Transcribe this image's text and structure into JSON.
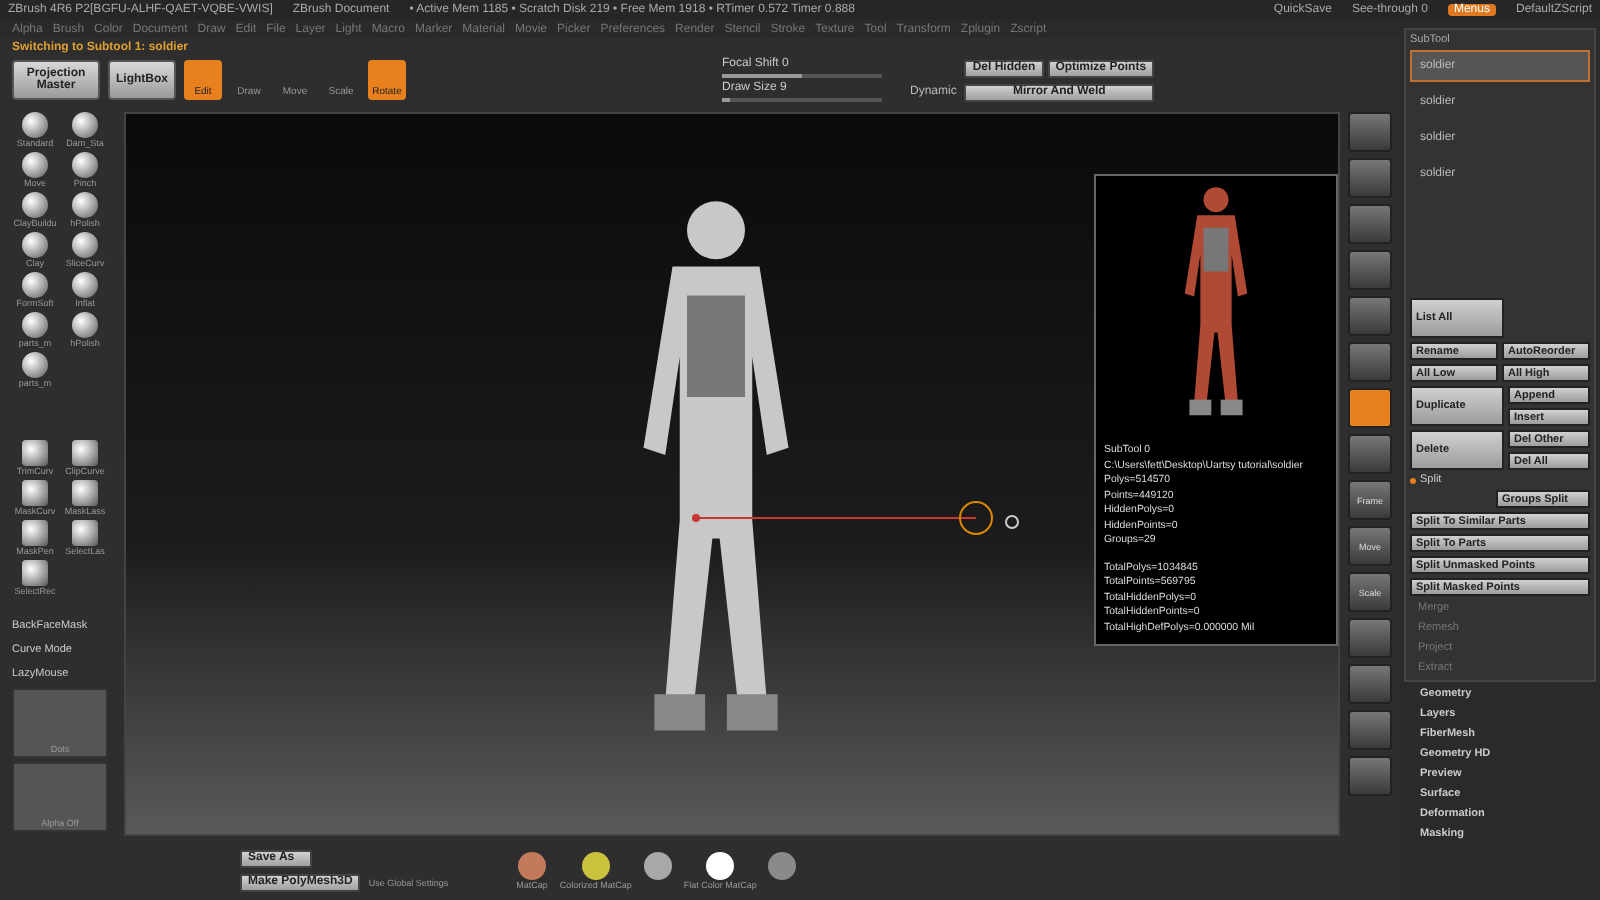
{
  "title_bar": {
    "title": "ZBrush 4R6 P2[BGFU-ALHF-QAET-VQBE-VWIS]",
    "document": "ZBrush Document",
    "stats": "• Active Mem 1185 • Scratch Disk 219 • Free Mem 1918 • RTimer 0.572 Timer 0.888",
    "quick_save": "QuickSave",
    "see_through": "See-through 0",
    "menus": "Menus",
    "script": "DefaultZScript",
    "menus_on": true
  },
  "menu_bar": [
    "Alpha",
    "Brush",
    "Color",
    "Document",
    "Draw",
    "Edit",
    "File",
    "Layer",
    "Light",
    "Macro",
    "Marker",
    "Material",
    "Movie",
    "Picker",
    "Preferences",
    "Render",
    "Stencil",
    "Stroke",
    "Texture",
    "Tool",
    "Transform",
    "Zplugin",
    "Zscript"
  ],
  "status": "Switching to Subtool 1: soldier",
  "toolbar": {
    "large_buttons": [
      "Projection Master",
      "LightBox"
    ],
    "modes": [
      {
        "label": "Edit",
        "selected": true
      },
      {
        "label": "Draw",
        "selected": false
      },
      {
        "label": "Move",
        "selected": false
      },
      {
        "label": "Scale",
        "selected": false
      },
      {
        "label": "Rotate",
        "selected": true
      }
    ],
    "sliders": [
      {
        "label": "Focal Shift 0",
        "level": 0.5
      },
      {
        "label": "Draw Size 9",
        "level": 0.05
      }
    ],
    "dynamic": "Dynamic",
    "buttons": [
      "Del Hidden",
      "Optimize Points"
    ],
    "mirror": "Mirror And Weld"
  },
  "brushes": [
    "Standard",
    "Dam_Sta",
    "Move",
    "Pinch",
    "ClayBuildu",
    "hPolish",
    "Clay",
    "SliceCurv",
    "FormSoft",
    "Inflat",
    "parts_m",
    "hPolish",
    "parts_m"
  ],
  "selection_tools": [
    "TrimCurv",
    "ClipCurve",
    "MaskCurv",
    "MaskLass",
    "MaskPen",
    "SelectLas",
    "SelectRec"
  ],
  "shelf_toggles": [
    "BackFaceMask",
    "Curve Mode",
    "LazyMouse"
  ],
  "stroke": "Dots",
  "alpha": "Alpha Off",
  "info_popup": {
    "lines": [
      "SubTool 0",
      "C:\\Users\\fett\\Desktop\\Uartsy tutorial\\soldier",
      "Polys=514570",
      "Points=449120",
      "HiddenPolys=0",
      "HiddenPoints=0",
      "Groups=29"
    ],
    "totals": [
      "TotalPolys=1034845",
      "TotalPoints=569795",
      "TotalHiddenPolys=0",
      "TotalHiddenPoints=0",
      "TotalHighDefPolys=0.000000 Mil"
    ]
  },
  "view_icons": [
    {
      "selected": false
    },
    {
      "selected": false
    },
    {
      "selected": false
    },
    {
      "selected": false
    },
    {
      "selected": false
    },
    {
      "selected": false
    },
    {
      "selected": true
    },
    {
      "selected": false
    },
    {
      "label": "Frame",
      "selected": false
    },
    {
      "label": "Move",
      "selected": false
    },
    {
      "label": "Scale",
      "selected": false
    },
    {
      "selected": false
    },
    {
      "selected": false
    },
    {
      "selected": false
    },
    {
      "selected": false
    }
  ],
  "subtool_panel": {
    "header": "SubTool",
    "subtools": [
      {
        "name": "soldier",
        "selected": true
      },
      {
        "name": "soldier",
        "selected": false
      },
      {
        "name": "soldier",
        "selected": false
      },
      {
        "name": "soldier",
        "selected": false
      }
    ],
    "buttons": [
      [
        "List All"
      ],
      [
        "Rename",
        "AutoReorder"
      ],
      [
        "All Low",
        "All High"
      ],
      [
        "Duplicate",
        "Append",
        "Insert"
      ],
      [
        "Delete",
        "Del Other",
        "Del All"
      ]
    ],
    "split_header": "Split",
    "groups_split": "Groups Split",
    "split_buttons": [
      "Split To Similar Parts",
      "Split To Parts",
      "Split Unmasked Points",
      "Split Masked Points"
    ],
    "dim_items": [
      "Merge",
      "Remesh",
      "Project",
      "Extract"
    ]
  },
  "tool_sections": [
    "Geometry",
    "Layers",
    "FiberMesh",
    "Geometry HD",
    "Preview",
    "Surface",
    "Deformation",
    "Masking"
  ],
  "bottom_bar": {
    "save_as": "Save As",
    "make_polymesh": "Make PolyMesh3D",
    "use_global": "Use Global Settings",
    "materials": [
      {
        "label": "MatCap",
        "color": "#c27a5a"
      },
      {
        "label": "Colorized MatCap",
        "color": "#c9c23c"
      },
      {
        "color": "#a8a8a8"
      },
      {
        "label": "Flat Color MatCap",
        "color": "#ffffff"
      },
      {
        "color": "#8a8a8a"
      }
    ]
  }
}
